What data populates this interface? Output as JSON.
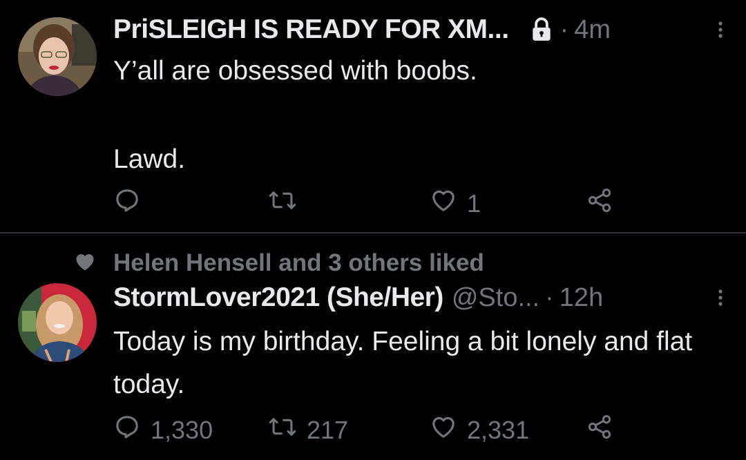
{
  "tweets": [
    {
      "display_name": "PriSLEIGH IS READY FOR XM...",
      "time": "4m",
      "text_line1": "Y’all are obsessed with boobs.",
      "text_line2": "Lawd.",
      "like_count": "1",
      "protected": true
    },
    {
      "social_context": "Helen Hensell and 3 others liked",
      "display_name": "StormLover2021 (She/Her)",
      "handle": "@Sto...",
      "time": "12h",
      "text": "Today is my birthday. Feeling a bit lonely and flat today.",
      "reply_count": "1,330",
      "retweet_count": "217",
      "like_count": "2,331"
    }
  ],
  "separator": "·",
  "colors": {
    "background": "#000000",
    "text": "#e7e9ea",
    "secondary": "#71767b",
    "divider": "#2f3336"
  },
  "icons": [
    "lock-icon",
    "more-icon",
    "reply-icon",
    "retweet-icon",
    "heart-icon",
    "share-icon"
  ]
}
